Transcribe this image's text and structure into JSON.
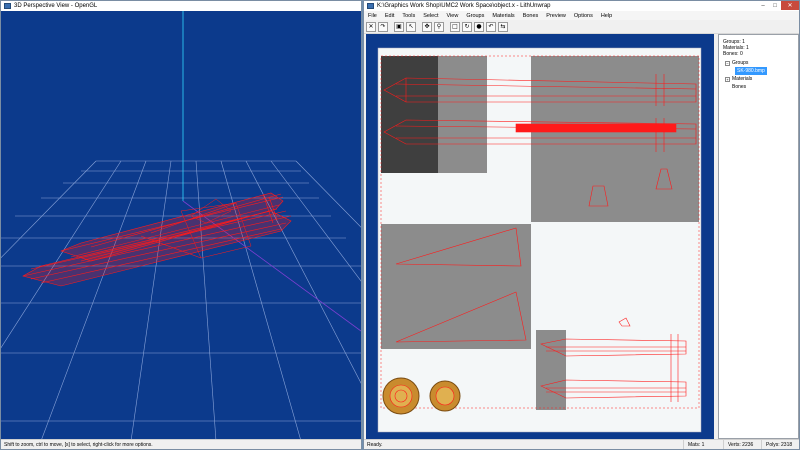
{
  "left_window": {
    "title": "3D Perspective View - OpenGL",
    "status": "Shift to zoom, ctrl to move, [s] to select, right-click for more options."
  },
  "right_window": {
    "title": "K:\\Graphics Work Shop\\UMC2 Work Space\\object.x - LithUnwrap",
    "menu": [
      "File",
      "Edit",
      "Tools",
      "Select",
      "View",
      "Groups",
      "Materials",
      "Bones",
      "Preview",
      "Options",
      "Help"
    ],
    "toolbar_icons": [
      "cut-icon",
      "redo-icon",
      "save-icon",
      "cursor-icon",
      "move-icon",
      "zoom-icon",
      "select-icon",
      "rotate-icon",
      "vertex-icon",
      "undo-icon",
      "flip-icon"
    ],
    "info": {
      "groups": "Groups: 1",
      "materials": "Materials: 1",
      "bones": "Bones: 0"
    },
    "tree": {
      "groups": "Groups",
      "group_item": "SK-980.bmp",
      "materials": "Materials",
      "bones": "Bones"
    },
    "status": {
      "ready": "Ready.",
      "mats": "Mats: 1",
      "verts": "Verts: 2236",
      "polys": "Polys: 2318"
    }
  },
  "colors": {
    "viewport_bg": "#0c3a8c",
    "wire": "#ff1a1a",
    "uv_bg": "#0c3a8c",
    "grid": "#9fb6e6"
  }
}
